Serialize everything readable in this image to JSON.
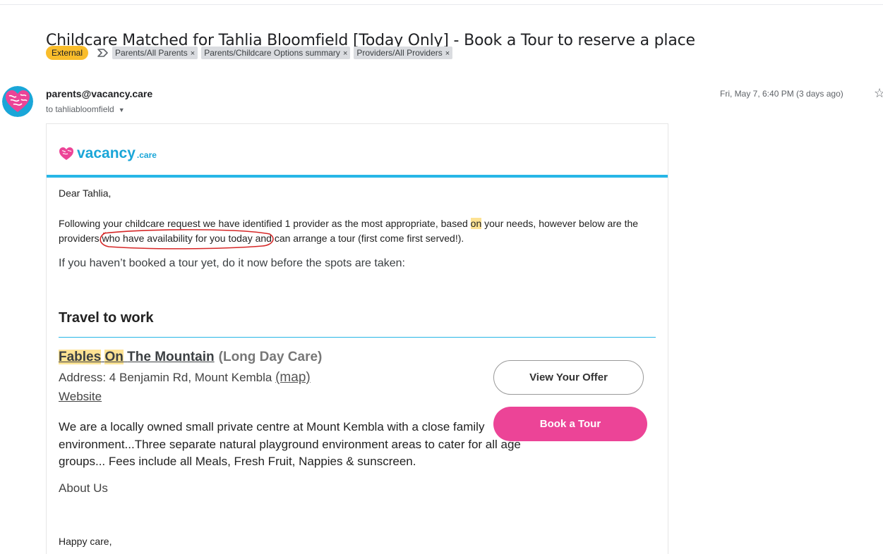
{
  "email": {
    "subject": "Childcare Matched for Tahlia Bloomfield [Today Only] - Book a Tour to reserve a place",
    "labels": {
      "external": "External",
      "chips": [
        "Parents/All Parents",
        "Parents/Childcare Options summary",
        "Providers/All Providers"
      ],
      "chip_close": "×"
    },
    "sender": "parents@vacancy.care",
    "recipient": "to tahliabloomfield",
    "date": "Fri, May 7, 6:40 PM (3 days ago)"
  },
  "body": {
    "logo": {
      "word": "vacancy",
      "tld": ".care"
    },
    "greeting": "Dear Tahlia,",
    "para_part1": "Following your childcare request we have identified 1 provider as the most appropriate, based ",
    "para_highlight": "on",
    "para_part2": " your needs, however below are the providers ",
    "para_circled": "who have availability for you today",
    "para_part3": " and can arrange a tour (first come first served!).",
    "cta_line": "If you haven’t booked a tour yet, do it now before the spots are taken:",
    "section_heading": "Travel to work",
    "provider": {
      "name_word1": "Fables",
      "name_word2": "On",
      "name_rest": "The Mountain",
      "type": "(Long Day Care)",
      "address_label": "Address: 4 Benjamin Rd, Mount Kembla ",
      "map_link": "(map)",
      "website": "Website",
      "description": "We are a locally owned small private centre at Mount Kembla with a close family environment...Three separate natural playground environment areas to cater for all age groups... Fees include all Meals, Fresh Fruit, Nappies & sunscreen.",
      "about": "About Us"
    },
    "buttons": {
      "view_offer": "View Your Offer",
      "book_tour": "Book a Tour"
    },
    "signoff": "Happy care,"
  },
  "colors": {
    "brand_blue": "#27b6e7",
    "brand_pink": "#ec4497",
    "highlight": "#fde293",
    "external_label": "#f9bd2b"
  }
}
